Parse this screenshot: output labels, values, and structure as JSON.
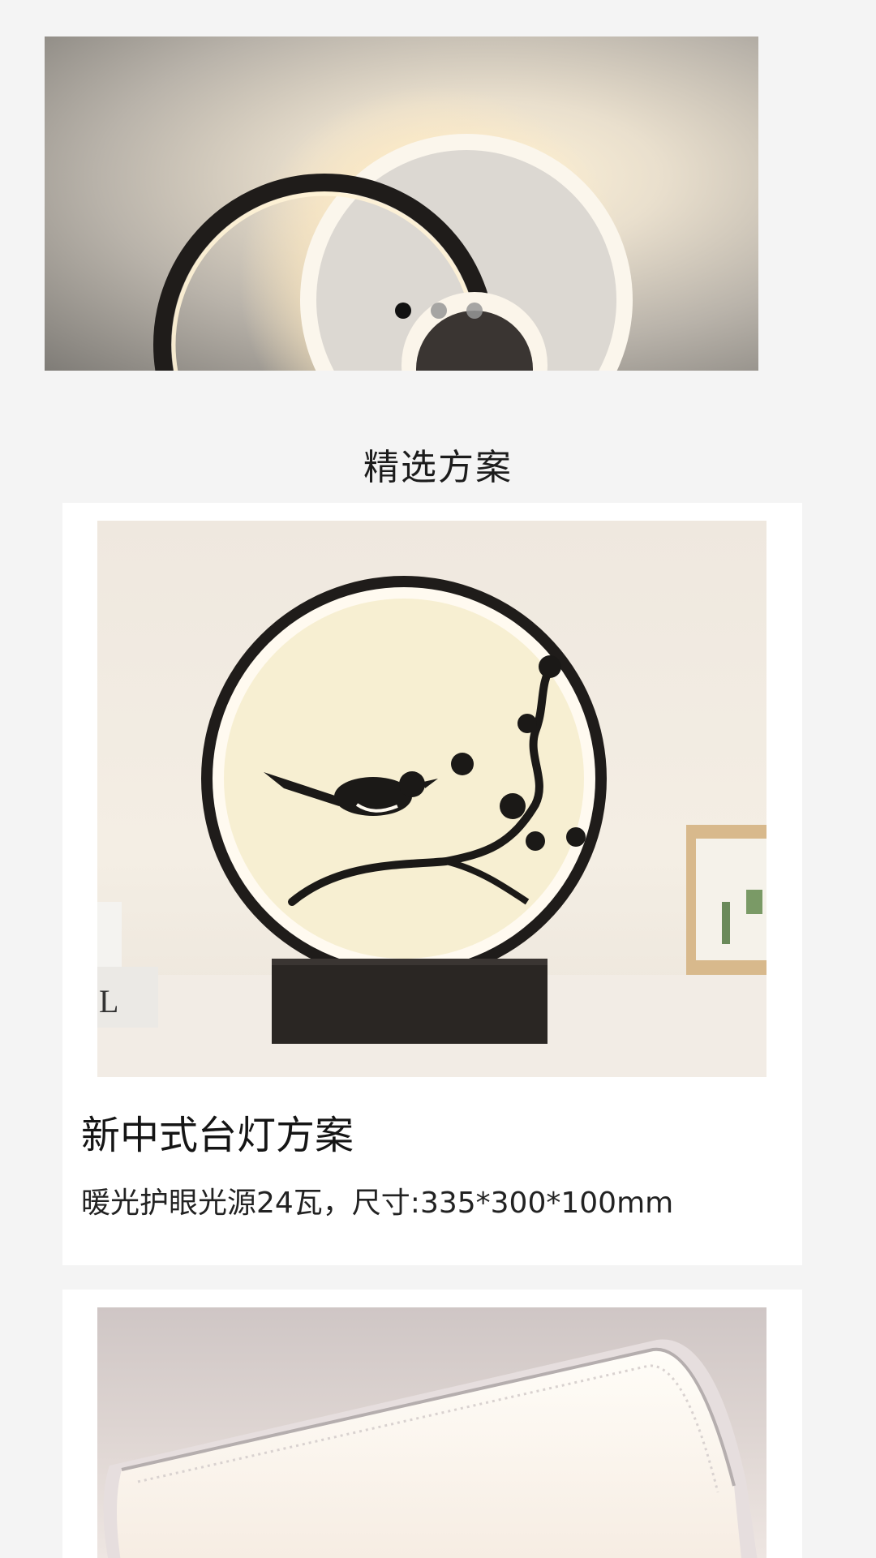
{
  "banner": {
    "slide_count": 3,
    "active_slide": 1
  },
  "section": {
    "title": "精选方案"
  },
  "cards": [
    {
      "title": "新中式台灯方案",
      "description": "暖光护眼光源24瓦，尺寸:335*300*100mm",
      "image": "table-lamp-bird-branch-image"
    },
    {
      "title": "",
      "description": "",
      "image": "ceiling-light-rectangle-image"
    }
  ],
  "colors": {
    "page_bg": "#f4f4f4",
    "card_bg": "#ffffff",
    "text": "#1c1c1c",
    "dot_active": "#111111",
    "dot_inactive": "#969696"
  }
}
